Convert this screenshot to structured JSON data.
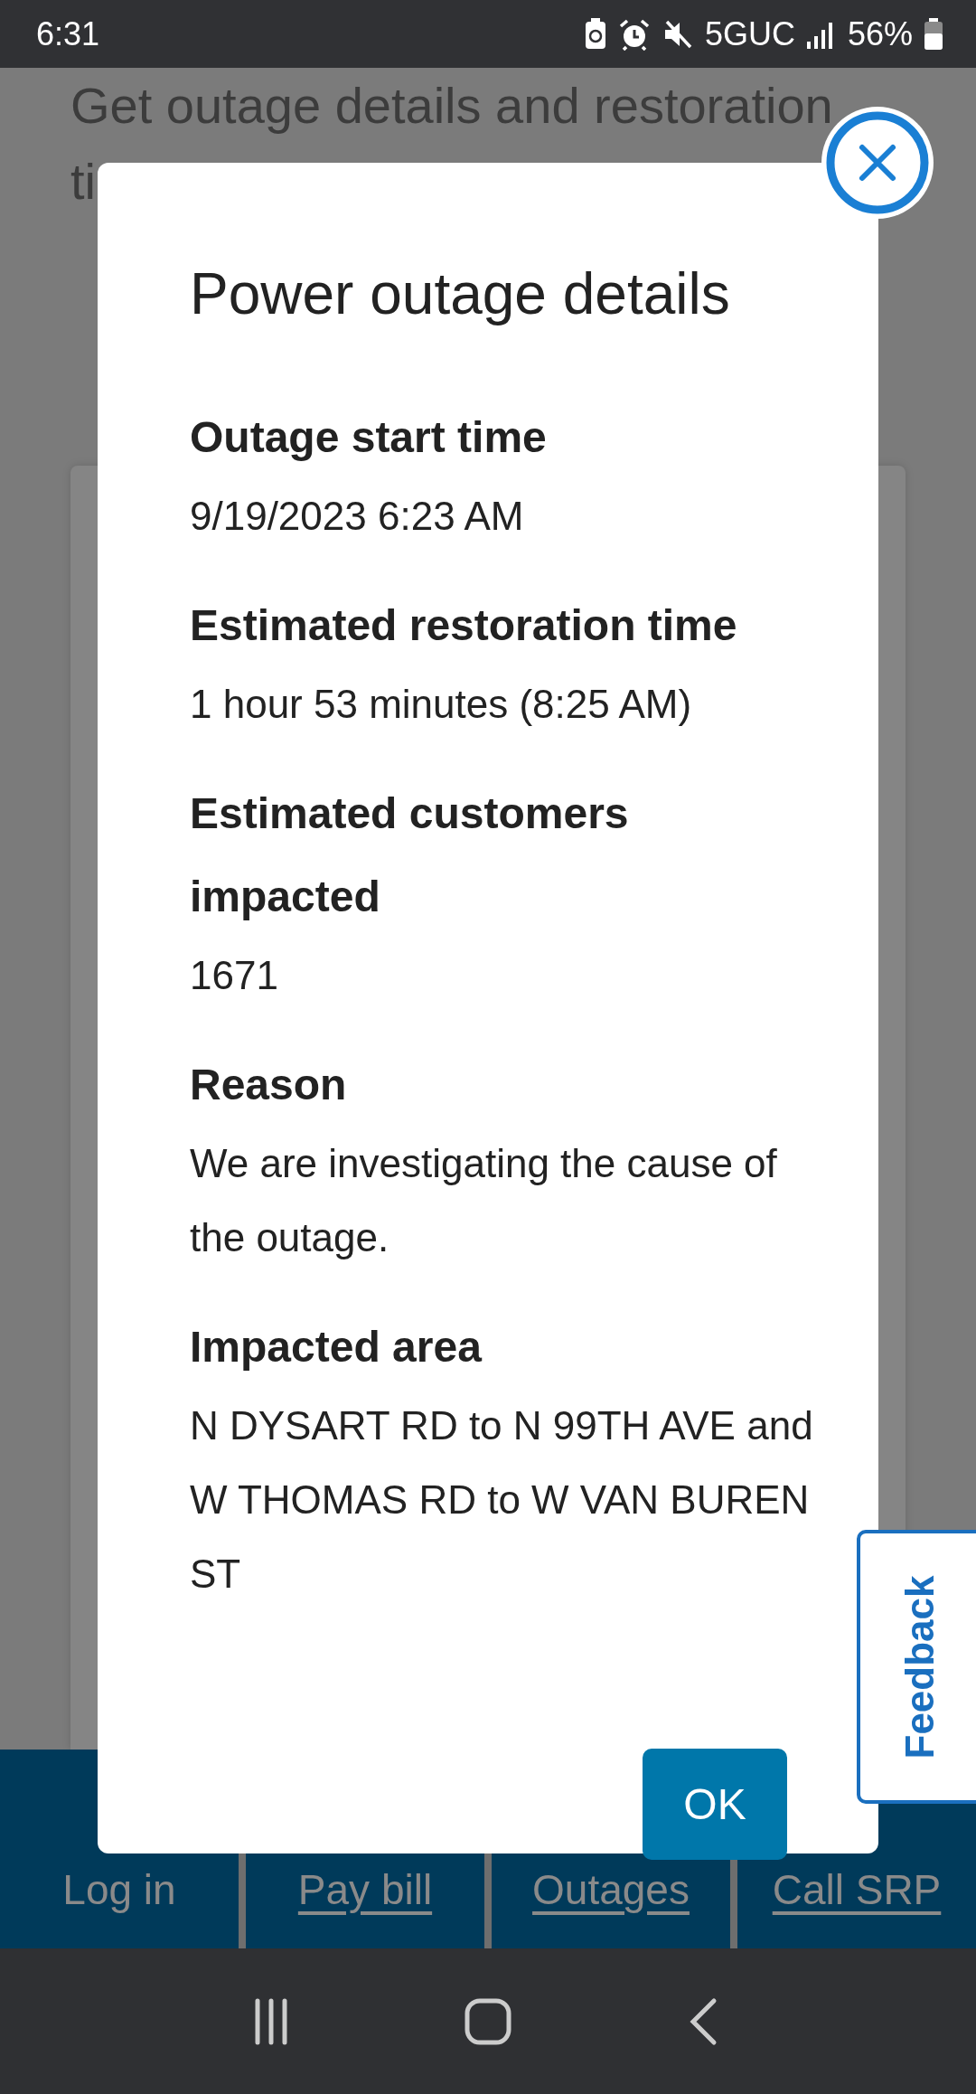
{
  "status_bar": {
    "time": "6:31",
    "network": "5GUC",
    "battery": "56%"
  },
  "background": {
    "intro": "Get outage details and restoration",
    "intro_cut": "ti"
  },
  "bottom_tabs": [
    {
      "label": "Log in",
      "link": false
    },
    {
      "label": "Pay bill",
      "link": true
    },
    {
      "label": "Outages",
      "link": true
    },
    {
      "label": "Call SRP",
      "link": true
    }
  ],
  "dialog": {
    "title": "Power outage details",
    "fields": [
      {
        "label": "Outage start time",
        "value": "9/19/2023 6:23 AM"
      },
      {
        "label": "Estimated restoration time",
        "value": "1 hour 53 minutes (8:25 AM)"
      },
      {
        "label": "Estimated customers impacted",
        "value": "1671"
      },
      {
        "label": "Reason",
        "value": "We are investigating the cause of the outage."
      },
      {
        "label": "Impacted area",
        "value": "N DYSART RD to N 99TH AVE and W THOMAS RD to W VAN BUREN ST"
      }
    ],
    "ok": "OK"
  },
  "feedback": "Feedback"
}
